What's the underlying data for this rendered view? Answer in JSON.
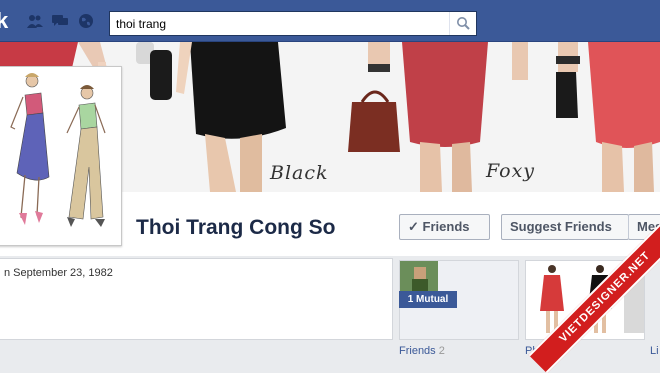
{
  "brand": {
    "logo_text": "k"
  },
  "nav": {
    "icons": [
      "friends-icon",
      "messages-icon",
      "notifications-globe-icon"
    ]
  },
  "search": {
    "value": "thoi trang",
    "icon": "search-icon"
  },
  "cover": {
    "captions": [
      "Black",
      "Foxy"
    ]
  },
  "profile": {
    "name": "Thoi Trang Cong So"
  },
  "actions": {
    "friends_label": "Friends",
    "friends_check": "✓",
    "suggest_label": "Suggest Friends",
    "message_label": "Mes"
  },
  "info": {
    "birthday": "n September 23, 1982"
  },
  "apps": {
    "friends": {
      "label": "Friends",
      "count": "2",
      "mutual": "1 Mutual"
    },
    "photos": {
      "label": "Photos"
    },
    "next": {
      "label": "Li"
    }
  },
  "watermark": {
    "text": "VIETDESIGNER.NET"
  },
  "colors": {
    "facebook_blue": "#3b5998",
    "dark_blue": "#1c2a47",
    "ribbon_red": "#d21e1e"
  }
}
